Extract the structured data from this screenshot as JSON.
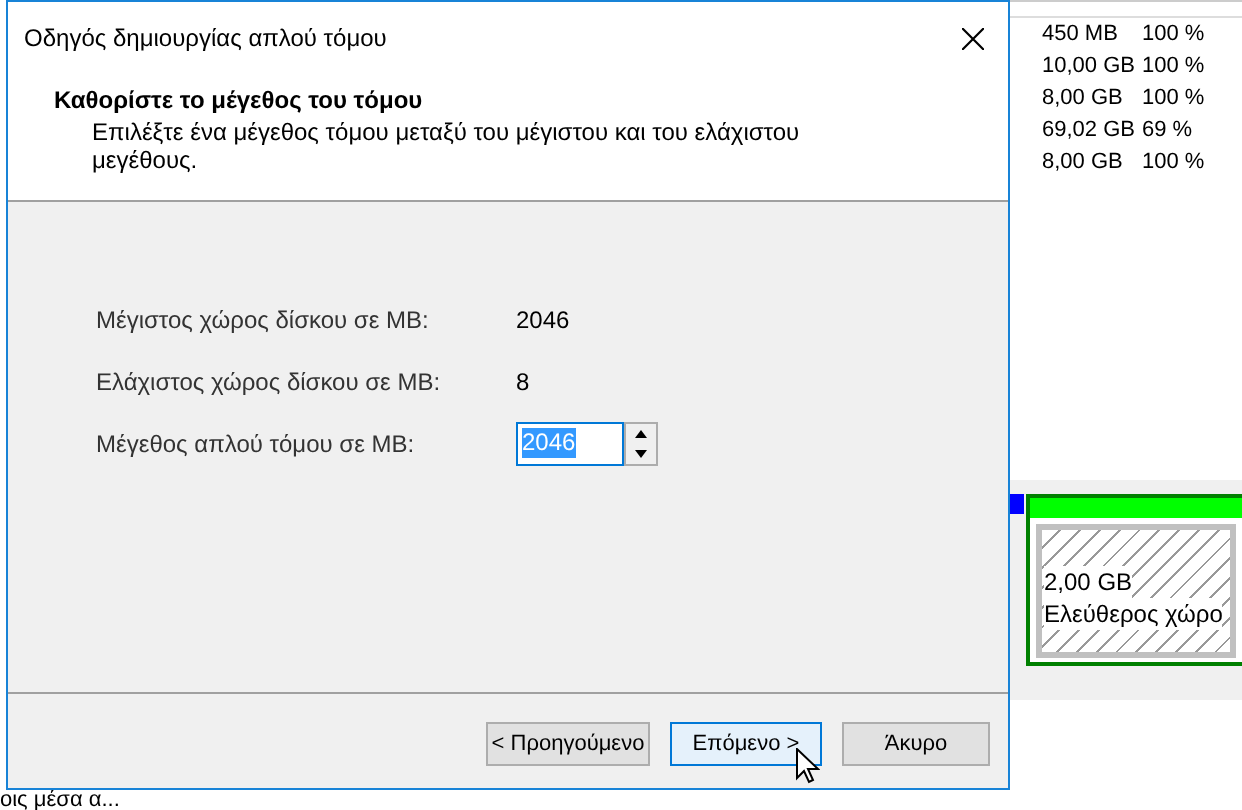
{
  "background_window": {
    "volumes": [
      {
        "capacity": "450 MB",
        "percent_free": "100 %"
      },
      {
        "capacity": "10,00 GB",
        "percent_free": "100 %"
      },
      {
        "capacity": "8,00 GB",
        "percent_free": "100 %"
      },
      {
        "capacity": "69,02 GB",
        "percent_free": "69 %"
      },
      {
        "capacity": "8,00 GB",
        "percent_free": "100 %"
      }
    ],
    "free_space": {
      "size": "2,00 GB",
      "label": "Ελεύθερος χώρο"
    },
    "bottom_fragment": "οις μέσα α..."
  },
  "dialog": {
    "title": "Οδηγός δημιουργίας απλού τόμου",
    "heading": "Καθορίστε το μέγεθος του τόμου",
    "description": "Επιλέξτε ένα μέγεθος τόμου μεταξύ του μέγιστου και του ελάχιστου μεγέθους.",
    "fields": [
      {
        "kind": "readout",
        "label": "Μέγιστος χώρος δίσκου σε MB:",
        "value": "2046"
      },
      {
        "kind": "readout",
        "label": "Ελάχιστος χώρος δίσκου σε MB:",
        "value": "8"
      },
      {
        "kind": "spinner",
        "label": "Μέγεθος απλού τόμου σε MB:",
        "value": "2046"
      }
    ],
    "buttons": [
      {
        "label": "< Προηγούμενο",
        "selected": false
      },
      {
        "label": "Επόμενο >",
        "selected": true
      },
      {
        "label": "Άκυρο",
        "selected": false
      }
    ]
  }
}
